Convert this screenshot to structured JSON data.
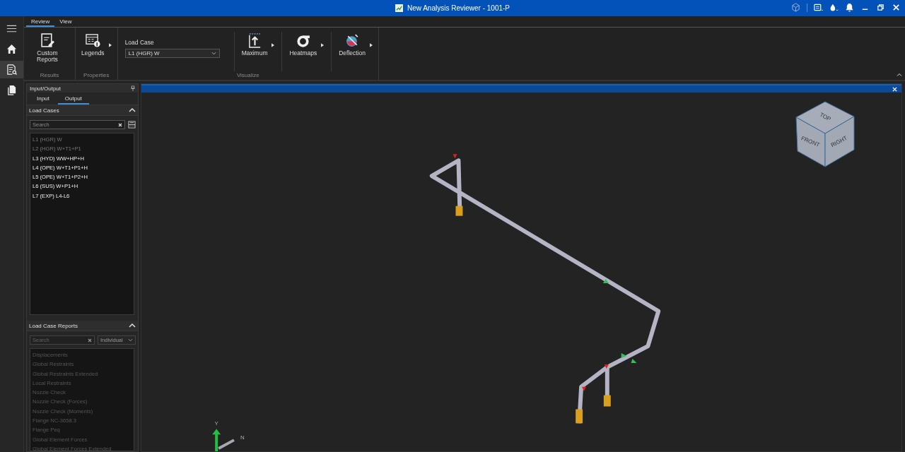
{
  "window": {
    "title": "New Analysis Reviewer - 1001-P"
  },
  "ribbon": {
    "tabs": [
      {
        "label": "Review",
        "selected": true
      },
      {
        "label": "View",
        "selected": false
      }
    ],
    "groups": [
      {
        "label": "Results",
        "items": [
          {
            "kind": "report",
            "label": "Custom Reports",
            "dropdown": false
          }
        ]
      },
      {
        "label": "Properties",
        "items": [
          {
            "kind": "legend",
            "label": "Legends",
            "dropdown": true
          }
        ]
      },
      {
        "label": "Visualize",
        "items": [
          {
            "kind": "combo",
            "label": "Load Case",
            "value": "L1 (HGR) W"
          },
          {
            "kind": "maximum",
            "label": "Maximum",
            "dropdown": true
          },
          {
            "kind": "heatmap",
            "label": "Heatmaps",
            "dropdown": true
          },
          {
            "kind": "deflection",
            "label": "Deflection",
            "dropdown": true
          }
        ]
      }
    ]
  },
  "panel": {
    "title": "Input/Output",
    "tabs": [
      {
        "label": "Input",
        "selected": false
      },
      {
        "label": "Output",
        "selected": true
      }
    ],
    "load_cases": {
      "title": "Load Cases",
      "expanded": true,
      "search": {
        "placeholder": "Search"
      },
      "items": [
        {
          "label": "L1 (HGR) W",
          "disabled": true
        },
        {
          "label": "L2 (HGR) W+T1+P1",
          "disabled": true
        },
        {
          "label": "L3 (HYD) WW+HP+H",
          "disabled": false
        },
        {
          "label": "L4 (OPE) W+T1+P1+H",
          "disabled": false
        },
        {
          "label": "L5 (OPE) W+T1+P2+H",
          "disabled": false
        },
        {
          "label": "L6 (SUS) W+P1+H",
          "disabled": false
        },
        {
          "label": "L7 (EXP) L4-L6",
          "disabled": false
        }
      ]
    },
    "load_case_reports": {
      "title": "Load Case Reports",
      "expanded": true,
      "search": {
        "placeholder": "Search"
      },
      "mode": "Individual",
      "items": [
        {
          "label": "Displacements",
          "disabled": true
        },
        {
          "label": "Global Restraints",
          "disabled": true
        },
        {
          "label": "Global Restraints Extended",
          "disabled": true
        },
        {
          "label": "Local Restraints",
          "disabled": true
        },
        {
          "label": "Nozzle Check",
          "disabled": true
        },
        {
          "label": "Nozzle Check (Forces)",
          "disabled": true
        },
        {
          "label": "Nozzle Check (Moments)",
          "disabled": true
        },
        {
          "label": "Flange NC-3658.3",
          "disabled": true
        },
        {
          "label": "Flange Peq",
          "disabled": true
        },
        {
          "label": "Global Element Forces",
          "disabled": true
        },
        {
          "label": "Global Element Forces Extended",
          "disabled": true
        }
      ]
    }
  },
  "viewport": {
    "view_cube": {
      "top": "TOP",
      "front": "FRONT",
      "right": "RIGHT"
    },
    "axes": {
      "y": "Y",
      "n": "N"
    }
  }
}
